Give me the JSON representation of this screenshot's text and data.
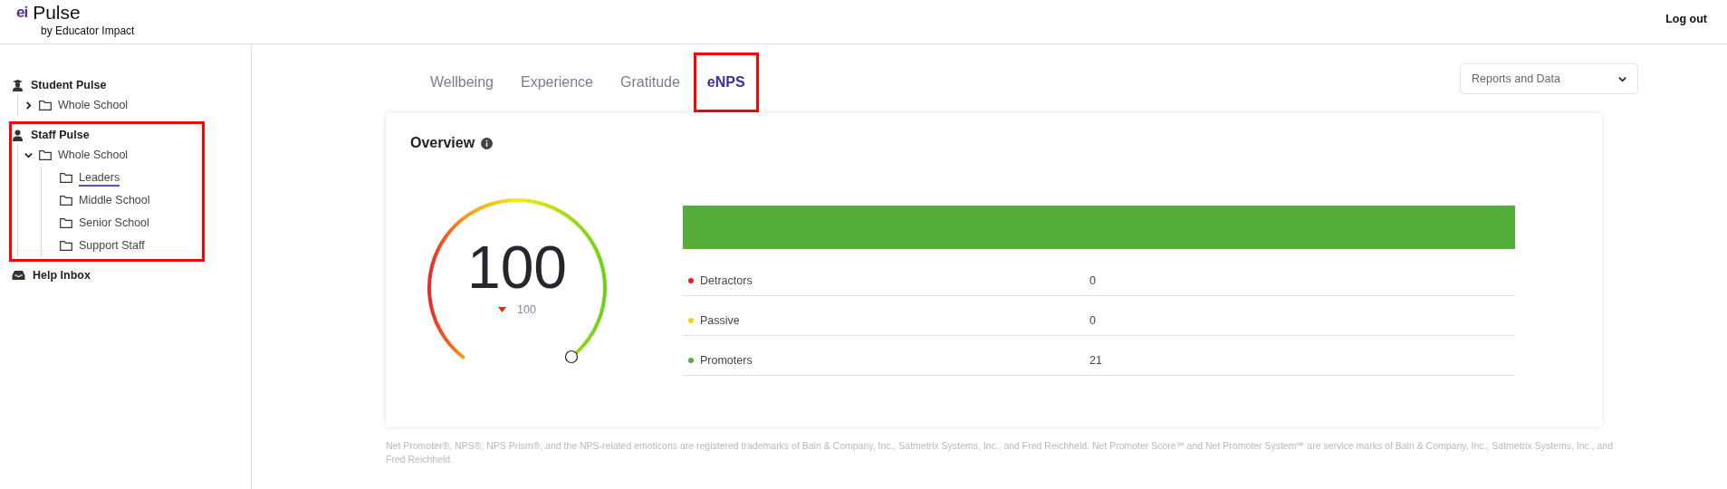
{
  "header": {
    "logo_mark": "ei",
    "title": "Pulse",
    "subtitle": "by Educator Impact",
    "logout": "Log out"
  },
  "sidebar": {
    "sections": [
      {
        "kind": "student",
        "label": "Student Pulse",
        "highlighted": false,
        "children": [
          {
            "label": "Whole School",
            "expanded": false,
            "selected": false
          }
        ]
      },
      {
        "kind": "staff",
        "label": "Staff Pulse",
        "highlighted": true,
        "children": [
          {
            "label": "Whole School",
            "expanded": true,
            "selected": false,
            "children": [
              {
                "label": "Leaders",
                "selected": true
              },
              {
                "label": "Middle School",
                "selected": false
              },
              {
                "label": "Senior School",
                "selected": false
              },
              {
                "label": "Support Staff",
                "selected": false
              }
            ]
          }
        ]
      },
      {
        "kind": "inbox",
        "label": "Help Inbox",
        "highlighted": false
      }
    ]
  },
  "tabs": [
    {
      "label": "Wellbeing",
      "selected": false,
      "highlighted": false
    },
    {
      "label": "Experience",
      "selected": false,
      "highlighted": false
    },
    {
      "label": "Gratitude",
      "selected": false,
      "highlighted": false
    },
    {
      "label": "eNPS",
      "selected": true,
      "highlighted": true
    }
  ],
  "reports_dropdown": {
    "label": "Reports and Data"
  },
  "overview": {
    "title": "Overview",
    "gauge": {
      "score": "100",
      "change": "100"
    },
    "breakdown": [
      {
        "label": "Detractors",
        "count": "0",
        "color": "#e8231b"
      },
      {
        "label": "Passive",
        "count": "0",
        "color": "#f2d21a"
      },
      {
        "label": "Promoters",
        "count": "21",
        "color": "#55ad3a"
      }
    ]
  },
  "footer": "Net Promoter®, NPS®, NPS Prism®, and the NPS-related emoticons are registered trademarks of Bain & Company, Inc., Satmetrix Systems, Inc., and Fred Reichheld. Net Promoter Score℠ and Net Promoter System℠ are service marks of Bain & Company, Inc., Satmetrix Systems, Inc., and Fred Reichheld."
}
